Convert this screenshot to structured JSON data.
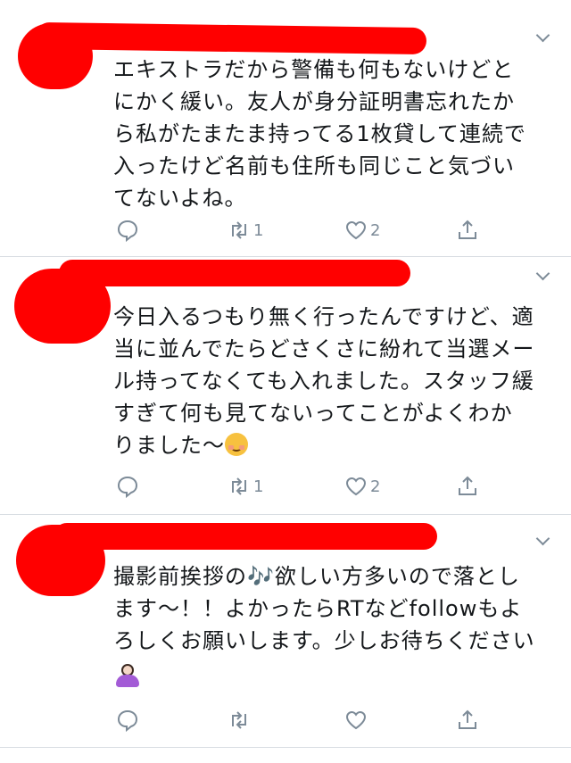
{
  "tweets": [
    {
      "text": "エキストラだから警備も何もないけどと\nにかく緩い。友人が身分証明書忘れたか\nら私がたまたま持ってる1枚貸して連続で\n入ったけど名前も住所も同じこと気づい\nてないよね。",
      "retweet_count": "1",
      "like_count": "2"
    },
    {
      "text": "今日入るつもり無く行ったんですけど、適\n当に並んでたらどさくさに紛れて当選メー\nル持ってなくても入れました。スタッフ緩\nすぎて何も見てないってことがよくわか\nりました〜",
      "emoji": "relieved-face-emoji",
      "retweet_count": "1",
      "like_count": "2"
    },
    {
      "text": "撮影前挨拶の🎶欲しい方多いので落とし\nます〜！！よかったらRTなどfollowもよ\nろしくお願いします。少しお待ちください",
      "emoji": "person-bowing-emoji",
      "retweet_count": "",
      "like_count": ""
    }
  ],
  "colors": {
    "redaction": "#ff0000",
    "icon": "#7d8b98",
    "text": "#14171a",
    "divider": "#d8dde2"
  }
}
